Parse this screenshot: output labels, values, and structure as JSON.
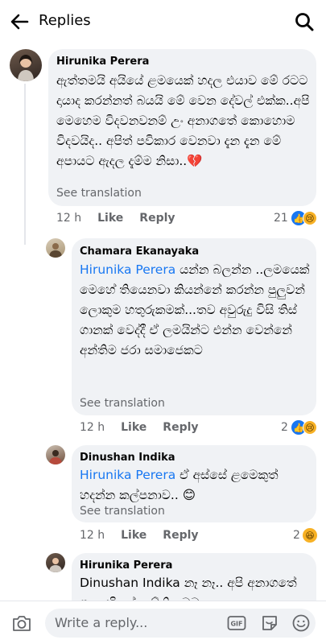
{
  "header": {
    "title": "Replies",
    "back_icon": "back-arrow-icon",
    "search_icon": "search-icon"
  },
  "comments": [
    {
      "author": "Hirunika Perera",
      "text": "ඇත්තමයි අයියේ ළමයෙක් හදල එයාව මේ රටට දායාද කරන්නත් බයයි මේ වෙන දේවල් එක්ක..අපි මෙහෙම විදවනවනම් උං අනාගතේ කොහොම විදවයිද.. අපිත් පවිකාර වෙනවා දැන දැන මේ අපායට ඇදල දැම්ම නිසා..💔",
      "see_translation": "See translation",
      "time": "12 h",
      "like": "Like",
      "reply": "Reply",
      "reaction_count": "21"
    },
    {
      "author": "Chamara Ekanayaka",
      "mention": "Hirunika Perera",
      "text": " යන්න බලන්න ..ලමයෙක් මෙහේ තියෙනවා කියන්නේ කරන්න පුලුවන් ලොකුම හතුරුකමක්...තව අවුරුදු විසි තිස් ගානක් වෙද්දී ඒ ලමයින්ට එන්න වෙන්නේ අන්තිම ජරා සමාජෙකට",
      "see_translation": "See translation",
      "time": "12 h",
      "like": "Like",
      "reply": "Reply",
      "reaction_count": "2"
    },
    {
      "author": "Dinushan Indika",
      "mention": "Hirunika Perera",
      "text": " ඒ අස්සේ ළමෙකුත් හදන්න කල්පනාව.. 😊",
      "see_translation": "See translation",
      "time": "12 h",
      "like": "Like",
      "reply": "Reply",
      "reaction_count": "2"
    },
    {
      "author": "Hirunika Perera",
      "mention": "Dinushan Indika",
      "text": " නෑ නෑ.. අපි අනාගතේ ගැන හිතන්න ඕනි.. මම"
    }
  ],
  "composer": {
    "placeholder": "Write a reply...",
    "gif_label": "GIF"
  }
}
